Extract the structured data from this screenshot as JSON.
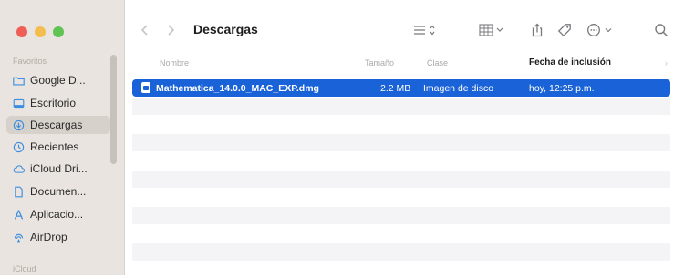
{
  "window": {
    "title": "Descargas"
  },
  "sidebar": {
    "sections": [
      {
        "label": "Favoritos"
      },
      {
        "label": "iCloud"
      }
    ],
    "items": [
      {
        "label": "Google D...",
        "icon": "folder-icon"
      },
      {
        "label": "Escritorio",
        "icon": "desktop-icon"
      },
      {
        "label": "Descargas",
        "icon": "download-icon"
      },
      {
        "label": "Recientes",
        "icon": "clock-icon"
      },
      {
        "label": "iCloud Dri...",
        "icon": "cloud-icon"
      },
      {
        "label": "Documen...",
        "icon": "document-icon"
      },
      {
        "label": "Aplicacio...",
        "icon": "applications-icon"
      },
      {
        "label": "AirDrop",
        "icon": "airdrop-icon"
      }
    ],
    "selected_label": "Descargas"
  },
  "toolbar": {
    "icons": [
      "back-icon",
      "forward-icon",
      "list-view-icon",
      "group-icon",
      "share-icon",
      "tag-icon",
      "more-icon",
      "search-icon"
    ]
  },
  "table": {
    "columns": [
      "Nombre",
      "Tamaño",
      "Clase",
      "Fecha de inclusión"
    ],
    "sorted_column": "Fecha de inclusión",
    "rows": [
      {
        "name": "Mathematica_14.0.0_MAC_EXP.dmg",
        "size": "2.2 MB",
        "kind": "Imagen de disco",
        "date_added": "hoy, 12:25 p.m.",
        "selected": true
      }
    ]
  },
  "colors": {
    "sidebar_bg": "#e9e4df",
    "selection": "#1a62d7",
    "accent_folder": "#3d8ee0"
  }
}
